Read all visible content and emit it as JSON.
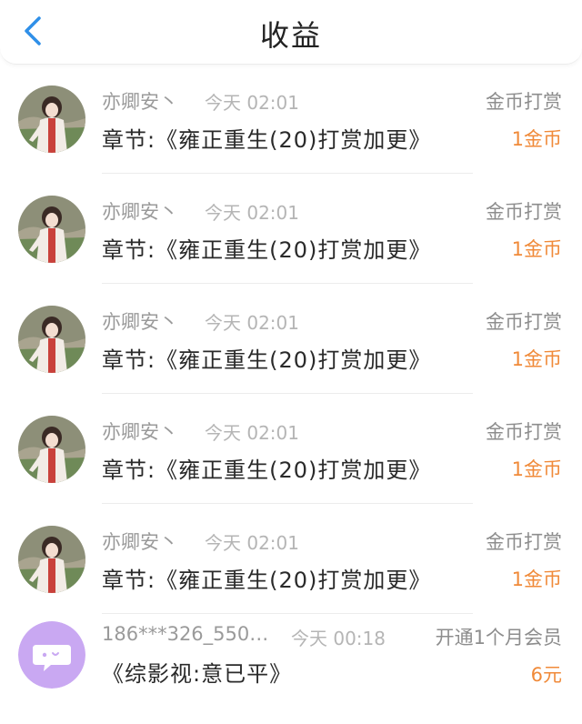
{
  "header": {
    "title": "收益"
  },
  "list": [
    {
      "user": "亦卿安丶",
      "time": "今天 02:01",
      "type": "金币打赏",
      "content": "章节:《雍正重生(20)打赏加更》",
      "amount": "1金币",
      "avatar": "doll-avatar"
    },
    {
      "user": "亦卿安丶",
      "time": "今天 02:01",
      "type": "金币打赏",
      "content": "章节:《雍正重生(20)打赏加更》",
      "amount": "1金币",
      "avatar": "doll-avatar"
    },
    {
      "user": "亦卿安丶",
      "time": "今天 02:01",
      "type": "金币打赏",
      "content": "章节:《雍正重生(20)打赏加更》",
      "amount": "1金币",
      "avatar": "doll-avatar"
    },
    {
      "user": "亦卿安丶",
      "time": "今天 02:01",
      "type": "金币打赏",
      "content": "章节:《雍正重生(20)打赏加更》",
      "amount": "1金币",
      "avatar": "doll-avatar"
    },
    {
      "user": "亦卿安丶",
      "time": "今天 02:01",
      "type": "金币打赏",
      "content": "章节:《雍正重生(20)打赏加更》",
      "amount": "1金币",
      "avatar": "doll-avatar"
    },
    {
      "user": "186***326_550…",
      "time": "今天 00:18",
      "type": "开通1个月会员",
      "content": "《综影视:意已平》",
      "amount": "6元",
      "avatar": "chat-bubble-avatar"
    }
  ],
  "colors": {
    "accent_blue": "#2f8fe8",
    "amount_orange": "#f08a39",
    "avatar_purple": "#c9a8f2"
  }
}
